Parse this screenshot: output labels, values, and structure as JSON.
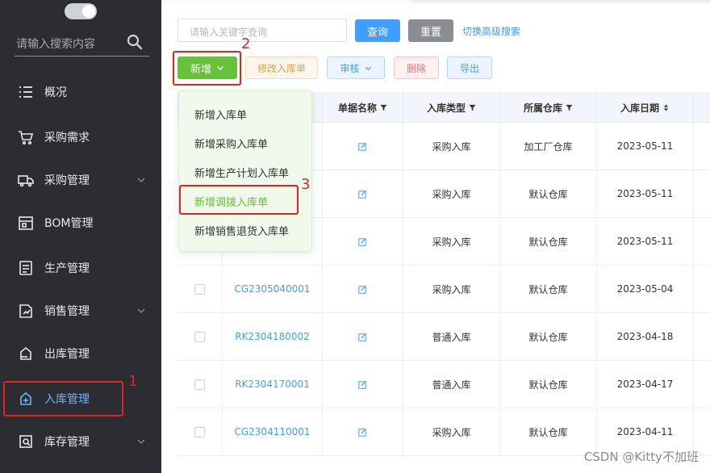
{
  "sidebar": {
    "search_placeholder": "请输入搜索内容",
    "items": [
      {
        "label": "概况",
        "icon": "list-icon"
      },
      {
        "label": "采购需求",
        "icon": "cart-icon"
      },
      {
        "label": "采购管理",
        "icon": "truck-icon"
      },
      {
        "label": "BOM管理",
        "icon": "bom-icon"
      },
      {
        "label": "生产管理",
        "icon": "production-icon"
      },
      {
        "label": "销售管理",
        "icon": "sales-icon"
      },
      {
        "label": "出库管理",
        "icon": "outbound-icon"
      },
      {
        "label": "入库管理",
        "icon": "inbound-icon"
      },
      {
        "label": "库存管理",
        "icon": "inventory-icon"
      }
    ]
  },
  "annotations": [
    "1",
    "2",
    "3"
  ],
  "toolbar": {
    "keyword_placeholder": "请输入关键字查询",
    "query_label": "查询",
    "reset_label": "重置",
    "advanced_link": "切换高级搜索",
    "add_label": "新增",
    "edit_label": "修改入库单",
    "audit_label": "审核",
    "delete_label": "删除",
    "export_label": "导出"
  },
  "add_menu": {
    "items": [
      "新增入库单",
      "新增采购入库单",
      "新增生产计划入库单",
      "新增调拨入库单",
      "新增销售退货入库单"
    ]
  },
  "table": {
    "headers": [
      "单据名称",
      "入库类型",
      "所属仓库",
      "入库日期"
    ],
    "rows": [
      {
        "code": "",
        "type": "采购入库",
        "warehouse": "加工厂仓库",
        "date": "2023-05-11"
      },
      {
        "code": "",
        "type": "采购入库",
        "warehouse": "默认仓库",
        "date": "2023-05-11"
      },
      {
        "code": "",
        "type": "采购入库",
        "warehouse": "默认仓库",
        "date": "2023-05-11"
      },
      {
        "code": "CG2305040001",
        "type": "采购入库",
        "warehouse": "默认仓库",
        "date": "2023-05-04"
      },
      {
        "code": "RK2304180002",
        "type": "普通入库",
        "warehouse": "默认仓库",
        "date": "2023-04-18"
      },
      {
        "code": "RK2304170001",
        "type": "普通入库",
        "warehouse": "默认仓库",
        "date": "2023-04-17"
      },
      {
        "code": "CG2304110001",
        "type": "采购入库",
        "warehouse": "默认仓库",
        "date": "2023-04-11"
      }
    ]
  },
  "colors": {
    "sidebar_bg": "#2c2d33",
    "primary": "#409eff",
    "success": "#67c23a",
    "annotation_red": "#e1241c"
  },
  "watermark": "CSDN @Kitty不加班"
}
